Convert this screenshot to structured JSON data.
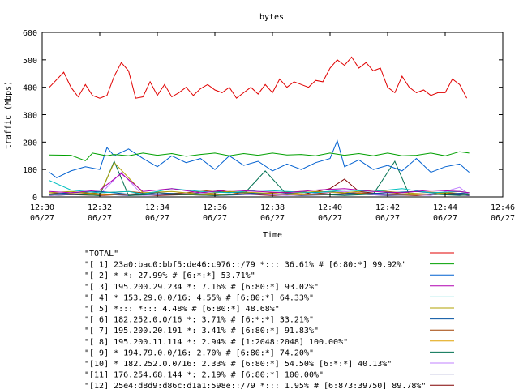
{
  "colors": {
    "total": "#e00000",
    "s1": "#00a000",
    "s2": "#0060d0",
    "s3": "#b000b0",
    "s4": "#00c0c0",
    "s5": "#b0a000",
    "s6": "#0050a0",
    "s7": "#a04000",
    "s8": "#e0a000",
    "s9": "#007050",
    "s10": "#c080ff",
    "s11": "#303090",
    "s12": "#800000"
  },
  "chart_data": {
    "type": "line",
    "title": "bytes",
    "xlabel": "Time",
    "ylabel": "traffic (Mbps)",
    "ylim": [
      0,
      600
    ],
    "xlim": [
      "12:30",
      "12:46"
    ],
    "yticks": [
      "0",
      "100",
      "200",
      "300",
      "400",
      "500",
      "600"
    ],
    "xticks": [
      {
        "time": "12:30",
        "date": "06/27"
      },
      {
        "time": "12:32",
        "date": "06/27"
      },
      {
        "time": "12:34",
        "date": "06/27"
      },
      {
        "time": "12:36",
        "date": "06/27"
      },
      {
        "time": "12:38",
        "date": "06/27"
      },
      {
        "time": "12:40",
        "date": "06/27"
      },
      {
        "time": "12:42",
        "date": "06/27"
      },
      {
        "time": "12:44",
        "date": "06/27"
      },
      {
        "time": "12:46",
        "date": "06/27"
      }
    ],
    "grid": false,
    "legend_position": "bottom",
    "series": [
      {
        "name": "\"TOTAL\"",
        "color_key": "total",
        "time": [
          "12:30:15",
          "12:30:45",
          "12:31:00",
          "12:31:15",
          "12:31:30",
          "12:31:45",
          "12:32:00",
          "12:32:15",
          "12:32:30",
          "12:32:45",
          "12:33:00",
          "12:33:15",
          "12:33:30",
          "12:33:45",
          "12:34:00",
          "12:34:15",
          "12:34:30",
          "12:34:45",
          "12:35:00",
          "12:35:15",
          "12:35:30",
          "12:35:45",
          "12:36:00",
          "12:36:15",
          "12:36:30",
          "12:36:45",
          "12:37:00",
          "12:37:15",
          "12:37:30",
          "12:37:45",
          "12:38:00",
          "12:38:15",
          "12:38:30",
          "12:38:45",
          "12:39:00",
          "12:39:15",
          "12:39:30",
          "12:39:45",
          "12:40:00",
          "12:40:15",
          "12:40:30",
          "12:40:45",
          "12:41:00",
          "12:41:15",
          "12:41:30",
          "12:41:45",
          "12:42:00",
          "12:42:15",
          "12:42:30",
          "12:42:45",
          "12:43:00",
          "12:43:15",
          "12:43:30",
          "12:43:45",
          "12:44:00",
          "12:44:15",
          "12:44:30",
          "12:44:45"
        ],
        "values": [
          400,
          455,
          400,
          365,
          410,
          370,
          360,
          370,
          440,
          490,
          460,
          360,
          365,
          420,
          370,
          410,
          365,
          380,
          400,
          370,
          395,
          410,
          390,
          380,
          400,
          360,
          380,
          400,
          375,
          410,
          380,
          430,
          400,
          420,
          410,
          400,
          425,
          420,
          470,
          500,
          480,
          510,
          470,
          490,
          460,
          470,
          400,
          380,
          440,
          400,
          380,
          390,
          370,
          380,
          380,
          430,
          410,
          360
        ]
      },
      {
        "name": "\"[ 1] 23a0:bac0:bbf5:de46:c976::/79 *::: 36.61% # [6:80:*] 99.92%\"",
        "color_key": "s1",
        "time": [
          "12:30:15",
          "12:31:00",
          "12:31:30",
          "12:31:45",
          "12:32:15",
          "12:32:30",
          "12:33:00",
          "12:33:30",
          "12:34:00",
          "12:34:30",
          "12:35:00",
          "12:35:30",
          "12:36:00",
          "12:36:30",
          "12:37:00",
          "12:37:30",
          "12:38:00",
          "12:38:30",
          "12:39:00",
          "12:39:30",
          "12:40:00",
          "12:40:30",
          "12:41:00",
          "12:41:30",
          "12:42:00",
          "12:42:30",
          "12:43:00",
          "12:43:30",
          "12:44:00",
          "12:44:30",
          "12:44:50"
        ],
        "values": [
          153,
          152,
          132,
          160,
          150,
          155,
          150,
          160,
          152,
          158,
          148,
          155,
          160,
          150,
          158,
          152,
          160,
          153,
          155,
          150,
          160,
          152,
          158,
          150,
          160,
          150,
          152,
          160,
          150,
          165,
          160
        ]
      },
      {
        "name": "\"[ 2] * *: 27.99% # [6:*:*] 53.71%\"",
        "color_key": "s2",
        "time": [
          "12:30:15",
          "12:30:30",
          "12:31:00",
          "12:31:30",
          "12:32:00",
          "12:32:15",
          "12:32:30",
          "12:33:00",
          "12:33:30",
          "12:34:00",
          "12:34:30",
          "12:35:00",
          "12:35:30",
          "12:36:00",
          "12:36:30",
          "12:37:00",
          "12:37:30",
          "12:38:00",
          "12:38:30",
          "12:39:00",
          "12:39:30",
          "12:40:00",
          "12:40:15",
          "12:40:30",
          "12:41:00",
          "12:41:30",
          "12:42:00",
          "12:42:30",
          "12:43:00",
          "12:43:30",
          "12:44:00",
          "12:44:30",
          "12:44:50"
        ],
        "values": [
          90,
          70,
          95,
          110,
          100,
          180,
          150,
          175,
          140,
          110,
          150,
          125,
          140,
          100,
          150,
          115,
          130,
          95,
          120,
          100,
          125,
          140,
          205,
          110,
          135,
          100,
          115,
          95,
          140,
          90,
          110,
          120,
          90
        ]
      },
      {
        "name": "\"[ 3] 195.200.29.234 *: 7.16% # [6:80:*] 93.02%\"",
        "color_key": "s3",
        "time": [
          "12:30:15",
          "12:31:00",
          "12:32:00",
          "12:32:45",
          "12:33:30",
          "12:34:30",
          "12:35:30",
          "12:36:30",
          "12:37:30",
          "12:38:30",
          "12:39:30",
          "12:40:30",
          "12:41:30",
          "12:42:30",
          "12:43:30",
          "12:44:30",
          "12:44:50"
        ],
        "values": [
          20,
          15,
          25,
          85,
          20,
          30,
          15,
          25,
          20,
          15,
          25,
          30,
          20,
          15,
          25,
          20,
          15
        ]
      },
      {
        "name": "\"[ 4] * 153.29.0.0/16: 4.55% # [6:80:*] 64.33%\"",
        "color_key": "s4",
        "time": [
          "12:30:15",
          "12:31:00",
          "12:32:00",
          "12:33:00",
          "12:33:30",
          "12:34:30",
          "12:35:30",
          "12:36:30",
          "12:37:30",
          "12:38:30",
          "12:39:30",
          "12:40:30",
          "12:41:30",
          "12:42:30",
          "12:43:30",
          "12:44:30",
          "12:44:50"
        ],
        "values": [
          60,
          25,
          15,
          20,
          10,
          30,
          20,
          15,
          25,
          20,
          15,
          25,
          20,
          30,
          15,
          20,
          15
        ]
      },
      {
        "name": "\"[ 5] *::: *::: 4.48% # [6:80:*] 48.68%\"",
        "color_key": "s5",
        "time": [
          "12:30:15",
          "12:31:00",
          "12:32:00",
          "12:32:30",
          "12:33:30",
          "12:34:30",
          "12:35:30",
          "12:36:30",
          "12:37:30",
          "12:38:30",
          "12:39:30",
          "12:40:30",
          "12:41:30",
          "12:42:30",
          "12:43:30",
          "12:44:30",
          "12:44:50"
        ],
        "values": [
          15,
          20,
          10,
          125,
          15,
          20,
          10,
          20,
          15,
          10,
          20,
          15,
          25,
          15,
          10,
          20,
          15
        ]
      },
      {
        "name": "\"[ 6] 182.252.0.0/16 *: 3.71% # [6:*:*] 33.21%\"",
        "color_key": "s6",
        "time": [
          "12:30:15",
          "12:31:00",
          "12:32:00",
          "12:33:00",
          "12:34:00",
          "12:35:00",
          "12:36:00",
          "12:37:00",
          "12:38:00",
          "12:39:00",
          "12:40:00",
          "12:41:00",
          "12:42:00",
          "12:43:00",
          "12:44:00",
          "12:44:50"
        ],
        "values": [
          10,
          15,
          20,
          10,
          15,
          10,
          20,
          15,
          10,
          15,
          20,
          10,
          15,
          20,
          10,
          15
        ]
      },
      {
        "name": "\"[ 7] 195.200.20.191 *: 3.41% # [6:80:*] 91.83%\"",
        "color_key": "s7",
        "time": [
          "12:30:15",
          "12:31:00",
          "12:32:00",
          "12:33:00",
          "12:34:00",
          "12:35:00",
          "12:36:00",
          "12:37:00",
          "12:38:00",
          "12:39:00",
          "12:40:00",
          "12:41:00",
          "12:42:00",
          "12:43:00",
          "12:44:00",
          "12:44:50"
        ],
        "values": [
          15,
          10,
          15,
          20,
          10,
          15,
          25,
          10,
          15,
          20,
          10,
          15,
          10,
          20,
          15,
          10
        ]
      },
      {
        "name": "\"[ 8] 195.200.11.114 *: 2.94% # [1:2048:2048] 100.00%\"",
        "color_key": "s8",
        "time": [
          "12:30:15",
          "12:31:00",
          "12:32:00",
          "12:33:00",
          "12:34:00",
          "12:35:00",
          "12:36:00",
          "12:37:00",
          "12:38:00",
          "12:39:00",
          "12:40:00",
          "12:41:00",
          "12:42:00",
          "12:43:00",
          "12:44:00",
          "12:44:50"
        ],
        "values": [
          10,
          12,
          8,
          10,
          15,
          10,
          8,
          12,
          10,
          8,
          10,
          12,
          10,
          8,
          12,
          10
        ]
      },
      {
        "name": "\"[ 9] * 194.79.0.0/16: 2.70% # [6:80:*] 74.20%\"",
        "color_key": "s9",
        "time": [
          "12:30:15",
          "12:31:00",
          "12:32:00",
          "12:32:30",
          "12:33:00",
          "12:34:00",
          "12:35:00",
          "12:36:00",
          "12:37:00",
          "12:37:45",
          "12:38:30",
          "12:39:30",
          "12:40:30",
          "12:41:30",
          "12:42:15",
          "12:42:45",
          "12:43:30",
          "12:44:30",
          "12:44:50"
        ],
        "values": [
          8,
          10,
          5,
          130,
          5,
          10,
          8,
          5,
          10,
          95,
          8,
          10,
          5,
          10,
          130,
          8,
          10,
          5,
          8
        ]
      },
      {
        "name": "\"[10] * 182.252.0.0/16: 2.33% # [6:80:*] 54.50% [6:*:*] 40.13%\"",
        "color_key": "s10",
        "time": [
          "12:30:15",
          "12:31:00",
          "12:32:00",
          "12:32:45",
          "12:33:30",
          "12:34:30",
          "12:35:30",
          "12:36:30",
          "12:37:30",
          "12:38:30",
          "12:39:30",
          "12:40:30",
          "12:41:30",
          "12:42:30",
          "12:43:30",
          "12:44:30",
          "12:44:50"
        ],
        "values": [
          5,
          10,
          8,
          90,
          5,
          10,
          15,
          8,
          10,
          5,
          12,
          20,
          8,
          10,
          5,
          35,
          8
        ]
      },
      {
        "name": "\"[11] 176.254.68.144 *: 2.19% # [6:80:*] 100.00%\"",
        "color_key": "s11",
        "time": [
          "12:30:15",
          "12:31:00",
          "12:32:00",
          "12:33:00",
          "12:34:00",
          "12:35:00",
          "12:36:00",
          "12:37:00",
          "12:38:00",
          "12:39:00",
          "12:40:00",
          "12:41:00",
          "12:42:00",
          "12:43:00",
          "12:44:00",
          "12:44:50"
        ],
        "values": [
          5,
          8,
          10,
          5,
          8,
          12,
          5,
          8,
          10,
          5,
          8,
          10,
          5,
          8,
          10,
          5
        ]
      },
      {
        "name": "\"[12] 25e4:d8d9:d86c:d1a1:598e::/79 *::: 1.95% # [6:873:39750] 89.78%\"",
        "color_key": "s12",
        "time": [
          "12:30:15",
          "12:31:00",
          "12:32:00",
          "12:33:00",
          "12:34:00",
          "12:35:00",
          "12:36:00",
          "12:37:00",
          "12:38:00",
          "12:39:00",
          "12:40:00",
          "12:40:30",
          "12:41:00",
          "12:42:00",
          "12:43:00",
          "12:44:00",
          "12:44:50"
        ],
        "values": [
          5,
          8,
          5,
          10,
          5,
          8,
          5,
          10,
          5,
          8,
          30,
          65,
          20,
          8,
          5,
          10,
          5
        ]
      }
    ]
  }
}
